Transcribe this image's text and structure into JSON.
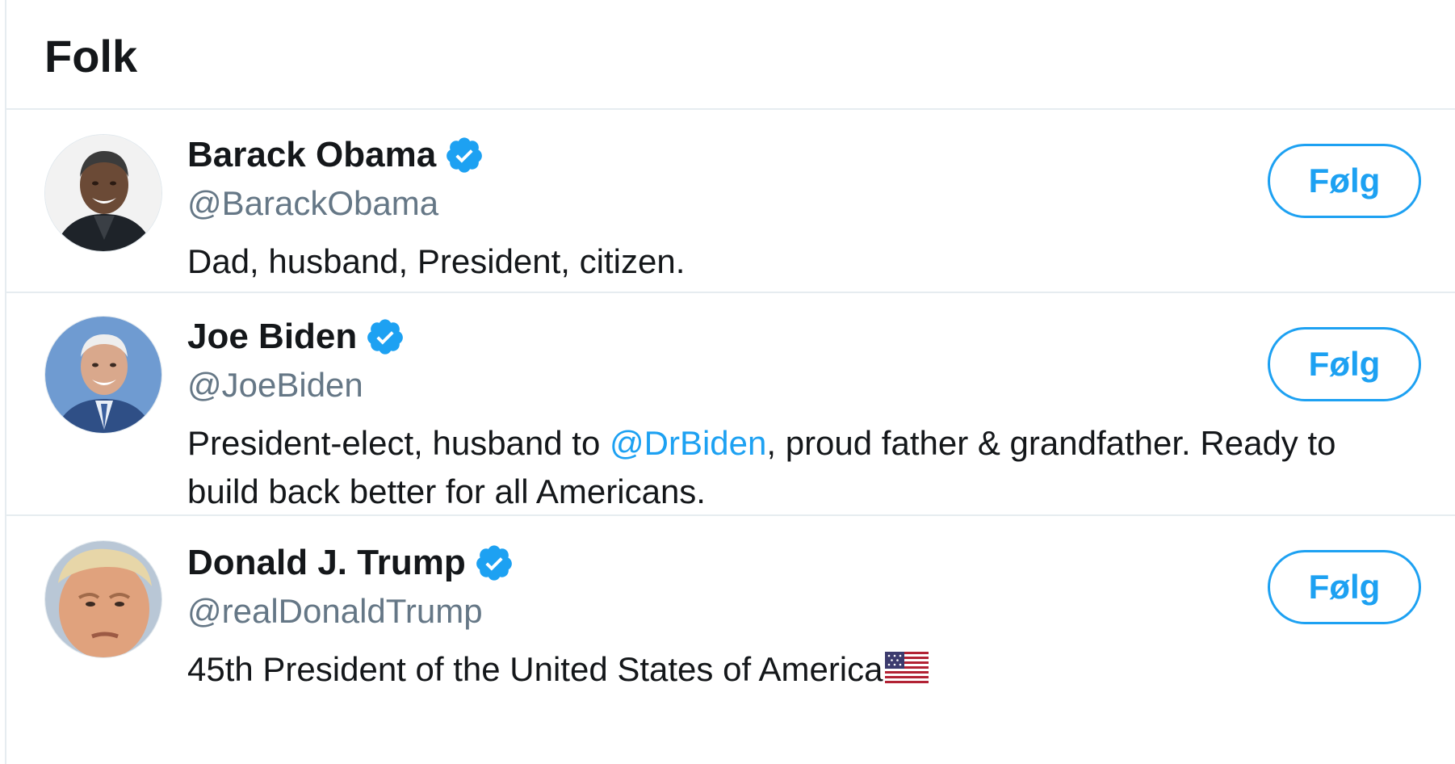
{
  "section": {
    "title": "Folk"
  },
  "colors": {
    "accent": "#1da1f2",
    "handle": "#657786",
    "divider": "#e6ecf0"
  },
  "users": [
    {
      "name": "Barack Obama",
      "handle": "@BarackObama",
      "verified": true,
      "bio": "Dad, husband, President, citizen.",
      "follow_label": "Følg"
    },
    {
      "name": "Joe Biden",
      "handle": "@JoeBiden",
      "verified": true,
      "bio_before": "President-elect, husband to ",
      "bio_mention": "@DrBiden",
      "bio_after": ", proud father & grandfather. Ready to build back better for all Americans.",
      "follow_label": "Følg"
    },
    {
      "name": "Donald J. Trump",
      "handle": "@realDonaldTrump",
      "verified": true,
      "bio": "45th President of the United States of America",
      "bio_icon": "us-flag-icon",
      "follow_label": "Følg"
    }
  ]
}
